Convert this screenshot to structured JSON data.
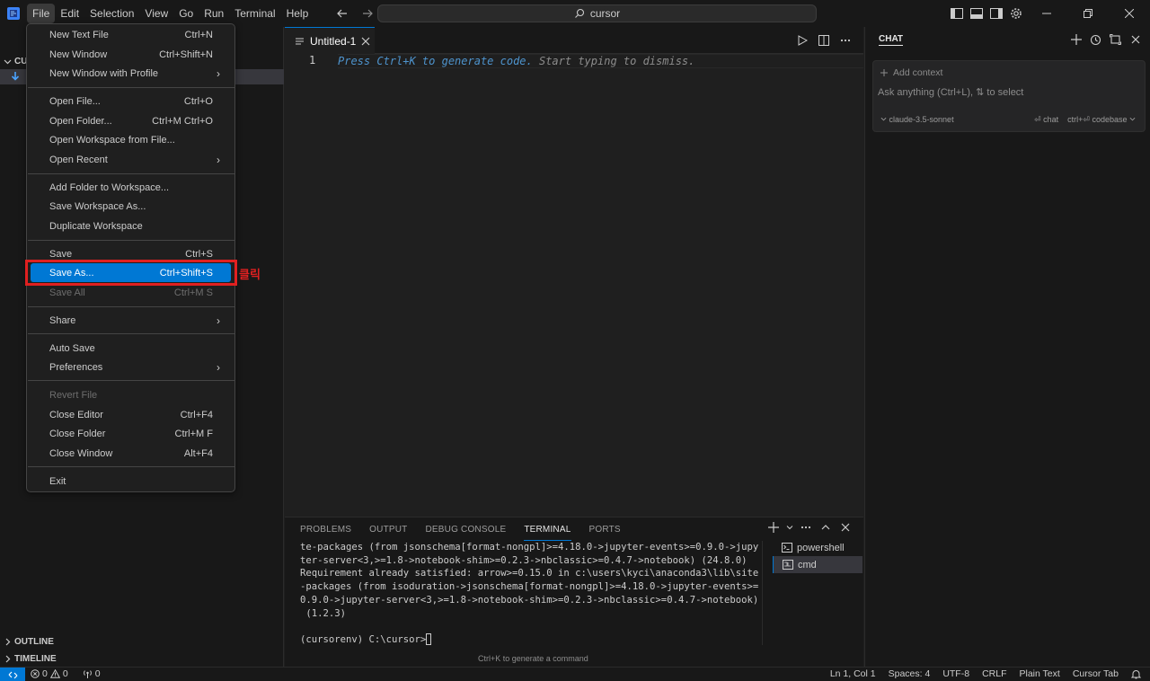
{
  "menubar": [
    "File",
    "Edit",
    "Selection",
    "View",
    "Go",
    "Run",
    "Terminal",
    "Help"
  ],
  "search": {
    "text": "cursor"
  },
  "sidebar": {
    "section_label": "CU",
    "outline": "OUTLINE",
    "timeline": "TIMELINE"
  },
  "editor": {
    "tab_label": "Untitled-1",
    "line_number": "1",
    "hint_key": "Press Ctrl+K to generate code.",
    "hint_rest": " Start typing to dismiss."
  },
  "file_menu": {
    "items": [
      {
        "label": "New Text File",
        "shortcut": "Ctrl+N"
      },
      {
        "label": "New Window",
        "shortcut": "Ctrl+Shift+N"
      },
      {
        "label": "New Window with Profile",
        "shortcut": ""
      },
      {
        "label": "Open File...",
        "shortcut": "Ctrl+O"
      },
      {
        "label": "Open Folder...",
        "shortcut": "Ctrl+M Ctrl+O"
      },
      {
        "label": "Open Workspace from File...",
        "shortcut": ""
      },
      {
        "label": "Open Recent",
        "shortcut": ""
      },
      {
        "label": "Add Folder to Workspace...",
        "shortcut": ""
      },
      {
        "label": "Save Workspace As...",
        "shortcut": ""
      },
      {
        "label": "Duplicate Workspace",
        "shortcut": ""
      },
      {
        "label": "Save",
        "shortcut": "Ctrl+S"
      },
      {
        "label": "Save As...",
        "shortcut": "Ctrl+Shift+S"
      },
      {
        "label": "Save All",
        "shortcut": "Ctrl+M S"
      },
      {
        "label": "Share",
        "shortcut": ""
      },
      {
        "label": "Auto Save",
        "shortcut": ""
      },
      {
        "label": "Preferences",
        "shortcut": ""
      },
      {
        "label": "Revert File",
        "shortcut": ""
      },
      {
        "label": "Close Editor",
        "shortcut": "Ctrl+F4"
      },
      {
        "label": "Close Folder",
        "shortcut": "Ctrl+M F"
      },
      {
        "label": "Close Window",
        "shortcut": "Alt+F4"
      },
      {
        "label": "Exit",
        "shortcut": ""
      }
    ]
  },
  "annotation": "클릭",
  "panel": {
    "tabs": [
      "PROBLEMS",
      "OUTPUT",
      "DEBUG CONSOLE",
      "TERMINAL",
      "PORTS"
    ],
    "terminal_lines": [
      "te-packages (from jsonschema[format-nongpl]>=4.18.0->jupyter-events>=0.9.0->jupy",
      "ter-server<3,>=1.8->notebook-shim>=0.2.3->nbclassic>=0.4.7->notebook) (24.8.0)",
      "Requirement already satisfied: arrow>=0.15.0 in c:\\users\\kyci\\anaconda3\\lib\\site",
      "-packages (from isoduration->jsonschema[format-nongpl]>=4.18.0->jupyter-events>=",
      "0.9.0->jupyter-server<3,>=1.8->notebook-shim>=0.2.3->nbclassic>=0.4.7->notebook)",
      " (1.2.3)",
      ""
    ],
    "prompt": "(cursorenv) C:\\cursor>",
    "hint": "Ctrl+K to generate a command",
    "terminals": [
      "powershell",
      "cmd"
    ]
  },
  "chat": {
    "title": "CHAT",
    "add_context": "Add context",
    "placeholder": "Ask anything (Ctrl+L), ⇅ to select",
    "model": "claude-3.5-sonnet",
    "chat_label": "⏎ chat",
    "codebase_label": "ctrl+⏎ codebase"
  },
  "status": {
    "errors": "0",
    "warnings": "0",
    "ports": "0",
    "position": "Ln 1, Col 1",
    "spaces": "Spaces: 4",
    "encoding": "UTF-8",
    "eol": "CRLF",
    "language": "Plain Text",
    "cursor_tab": "Cursor Tab"
  },
  "colors": {
    "accent": "#0078d4",
    "annotation": "#e02020"
  }
}
